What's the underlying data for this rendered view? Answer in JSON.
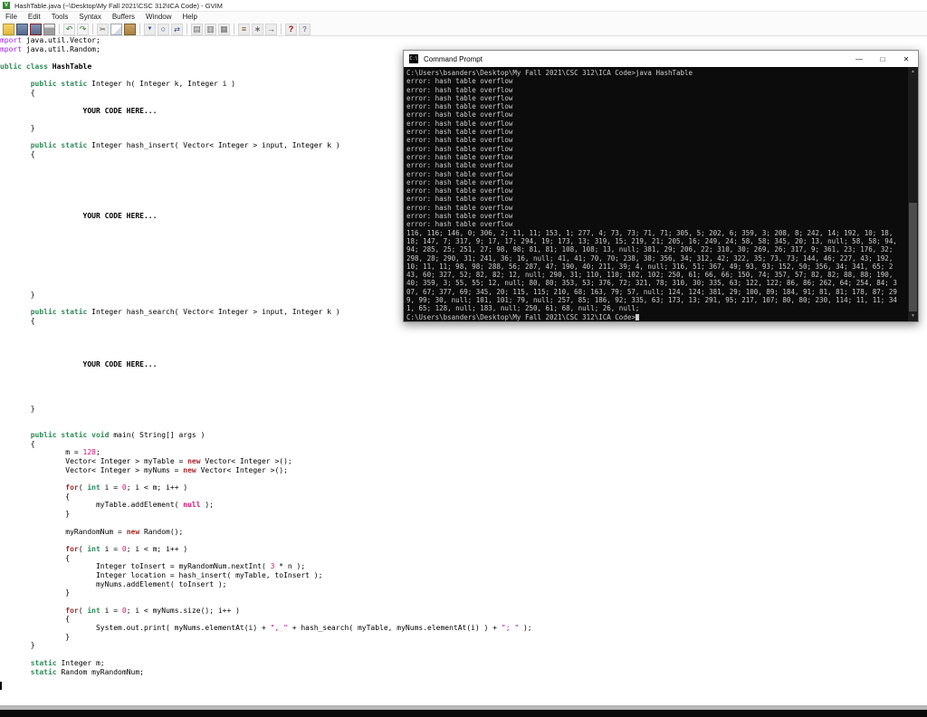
{
  "window": {
    "title": "HashTable.java (~\\Desktop\\My Fall 2021\\CSC 312\\ICA Code) - GVIM"
  },
  "menubar": {
    "items": [
      "File",
      "Edit",
      "Tools",
      "Syntax",
      "Buffers",
      "Window",
      "Help"
    ]
  },
  "toolbar": {
    "groups": [
      [
        "open-file",
        "save-file",
        "save-all",
        "print"
      ],
      [
        "undo",
        "redo"
      ],
      [
        "cut",
        "copy",
        "paste"
      ],
      [
        "find-next",
        "find",
        "replace"
      ],
      [
        "load-session",
        "save-session",
        "run-script"
      ],
      [
        "make",
        "build-tags",
        "jump-to-tag"
      ],
      [
        "help",
        "find-help"
      ]
    ]
  },
  "editor": {
    "lines": [
      [
        [
          "p",
          "mport"
        ],
        [
          "",
          " java.util.Vector;"
        ]
      ],
      [
        [
          "p",
          "mport"
        ],
        [
          "",
          " java.util.Random;"
        ]
      ],
      [],
      [
        [
          "t",
          "ublic class"
        ],
        [
          "b",
          " HashTable"
        ]
      ],
      [],
      [
        [
          "",
          "       "
        ],
        [
          "t",
          "public static"
        ],
        [
          "",
          " Integer h( Integer k, Integer i )"
        ]
      ],
      [
        [
          "",
          "       {"
        ]
      ],
      [],
      [
        [
          "",
          "                   "
        ],
        [
          "b",
          "YOUR CODE HERE..."
        ]
      ],
      [],
      [
        [
          "",
          "       }"
        ]
      ],
      [],
      [
        [
          "",
          "       "
        ],
        [
          "t",
          "public static"
        ],
        [
          "",
          " Integer hash_insert( Vector< Integer > input, Integer k )"
        ]
      ],
      [
        [
          "",
          "       {"
        ]
      ],
      [],
      [],
      [],
      [],
      [],
      [],
      [
        [
          "",
          "                   "
        ],
        [
          "b",
          "YOUR CODE HERE..."
        ]
      ],
      [],
      [],
      [],
      [],
      [],
      [],
      [],
      [],
      [
        [
          "",
          "       }"
        ]
      ],
      [],
      [
        [
          "",
          "       "
        ],
        [
          "t",
          "public static"
        ],
        [
          "",
          " Integer hash_search( Vector< Integer > input, Integer k )"
        ]
      ],
      [
        [
          "",
          "       {"
        ]
      ],
      [],
      [],
      [],
      [],
      [
        [
          "",
          "                   "
        ],
        [
          "b",
          "YOUR CODE HERE..."
        ]
      ],
      [],
      [],
      [],
      [],
      [
        [
          "",
          "       }"
        ]
      ],
      [],
      [],
      [
        [
          "",
          "       "
        ],
        [
          "t",
          "public static void"
        ],
        [
          "",
          " main( String[] args )"
        ]
      ],
      [
        [
          "",
          "       {"
        ]
      ],
      [
        [
          "",
          "               m = "
        ],
        [
          "n",
          "128"
        ],
        [
          "",
          ";"
        ]
      ],
      [
        [
          "",
          "               Vector< Integer > myTable = "
        ],
        [
          "s",
          "new"
        ],
        [
          "",
          " Vector< Integer >();"
        ]
      ],
      [
        [
          "",
          "               Vector< Integer > myNums = "
        ],
        [
          "s",
          "new"
        ],
        [
          "",
          " Vector< Integer >();"
        ]
      ],
      [],
      [
        [
          "",
          "               "
        ],
        [
          "s",
          "for"
        ],
        [
          "",
          "( "
        ],
        [
          "t",
          "int"
        ],
        [
          "",
          " i = "
        ],
        [
          "n",
          "0"
        ],
        [
          "",
          "; i < m; i++ )"
        ]
      ],
      [
        [
          "",
          "               {"
        ]
      ],
      [
        [
          "",
          "                      myTable.addElement( "
        ],
        [
          "c",
          "null"
        ],
        [
          "",
          " );"
        ]
      ],
      [
        [
          "",
          "               }"
        ]
      ],
      [],
      [
        [
          "",
          "               myRandomNum = "
        ],
        [
          "s",
          "new"
        ],
        [
          "",
          " Random();"
        ]
      ],
      [],
      [
        [
          "",
          "               "
        ],
        [
          "s",
          "for"
        ],
        [
          "",
          "( "
        ],
        [
          "t",
          "int"
        ],
        [
          "",
          " i = "
        ],
        [
          "n",
          "0"
        ],
        [
          "",
          "; i < m; i++ )"
        ]
      ],
      [
        [
          "",
          "               {"
        ]
      ],
      [
        [
          "",
          "                      Integer toInsert = myRandomNum.nextInt( "
        ],
        [
          "n",
          "3"
        ],
        [
          "",
          " * n );"
        ]
      ],
      [
        [
          "",
          "                      Integer location = hash_insert( myTable, toInsert );"
        ]
      ],
      [
        [
          "",
          "                      myNums.addElement( toInsert );"
        ]
      ],
      [
        [
          "",
          "               }"
        ]
      ],
      [],
      [
        [
          "",
          "               "
        ],
        [
          "s",
          "for"
        ],
        [
          "",
          "( "
        ],
        [
          "t",
          "int"
        ],
        [
          "",
          " i = "
        ],
        [
          "n",
          "0"
        ],
        [
          "",
          "; i < myNums.size(); i++ )"
        ]
      ],
      [
        [
          "",
          "               {"
        ]
      ],
      [
        [
          "",
          "                      System.out.print( myNums.elementAt(i) + "
        ],
        [
          "str",
          "\", \""
        ],
        [
          "",
          " + hash_search( myTable, myNums.elementAt(i) ) + "
        ],
        [
          "str",
          "\"; \""
        ],
        [
          "",
          " );"
        ]
      ],
      [
        [
          "",
          "               }"
        ]
      ],
      [
        [
          "",
          "       }"
        ]
      ],
      [],
      [
        [
          "",
          "       "
        ],
        [
          "t",
          "static"
        ],
        [
          "",
          " Integer m;"
        ]
      ],
      [
        [
          "",
          "       "
        ],
        [
          "t",
          "static"
        ],
        [
          "",
          " Random myRandomNum;"
        ]
      ]
    ]
  },
  "console": {
    "title": "Command Prompt",
    "icon_text": "C:\\",
    "controls": {
      "minimize": "—",
      "maximize": "□",
      "close": "✕"
    },
    "prompt_line": "C:\\Users\\bsanders\\Desktop\\My Fall 2021\\CSC 312\\ICA Code>java HashTable",
    "error_line": "error: hash table overflow",
    "error_count": 18,
    "output_lines": [
      "116, 116; 146, 0; 306, 2; 11, 11; 153, 1; 277, 4; 73, 73; 71, 71; 305, 5; 202, 6; 359, 3; 208, 8; 242, 14; 192, 10; 18,",
      "18; 147, 7; 317, 9; 17, 17; 294, 19; 173, 13; 319, 15; 219, 21; 205, 16; 249, 24; 58, 58; 345, 20; 13, null; 58, 58; 94,",
      "94; 285, 25; 251, 27; 98, 98; 81, 81; 108, 108; 13, null; 381, 29; 206, 22; 310, 30; 269, 26; 317, 9; 361, 23; 176, 32;",
      "298, 28; 290, 31; 241, 36; 16, null; 41, 41; 70, 70; 238, 38; 356, 34; 312, 42; 322, 35; 73, 73; 144, 46; 227, 43; 192,",
      "10; 11, 11; 98, 98; 288, 56; 287, 47; 190, 40; 211, 39; 4, null; 316, 51; 367, 49; 93, 93; 152, 50; 356, 34; 341, 65; 2",
      "43, 60; 327, 52; 82, 82; 12, null; 290, 31; 110, 110; 102, 102; 250, 61; 66, 66; 150, 74; 357, 57; 82, 82; 88, 88; 190,",
      "40; 359, 3; 55, 55; 12, null; 80, 80; 353, 53; 376, 72; 321, 78; 310, 30; 335, 63; 122, 122; 86, 86; 262, 64; 254, 84; 3",
      "07, 67; 377, 69; 345, 20; 115, 115; 210, 68; 163, 79; 57, null; 124, 124; 381, 29; 100, 89; 184, 91; 81, 81; 178, 87; 29",
      "9, 99; 30, null; 101, 101; 79, null; 257, 85; 186, 92; 335, 63; 173, 13; 291, 95; 217, 107; 80, 80; 230, 114; 11, 11; 34",
      "1, 65; 128, null; 183, null; 250, 61; 68, null; 26, null;"
    ],
    "final_prompt": "C:\\Users\\bsanders\\Desktop\\My Fall 2021\\CSC 312\\ICA Code>"
  },
  "colors": {
    "type_keyword": "#2e8b57",
    "statement_keyword": "#a52a2a",
    "preproc": "#a020f0",
    "number": "#e01070",
    "string": "#b000b0",
    "console_bg": "#0c0c0c",
    "console_fg": "#cccccc",
    "vim_icon_green": "#2e8b2e"
  }
}
